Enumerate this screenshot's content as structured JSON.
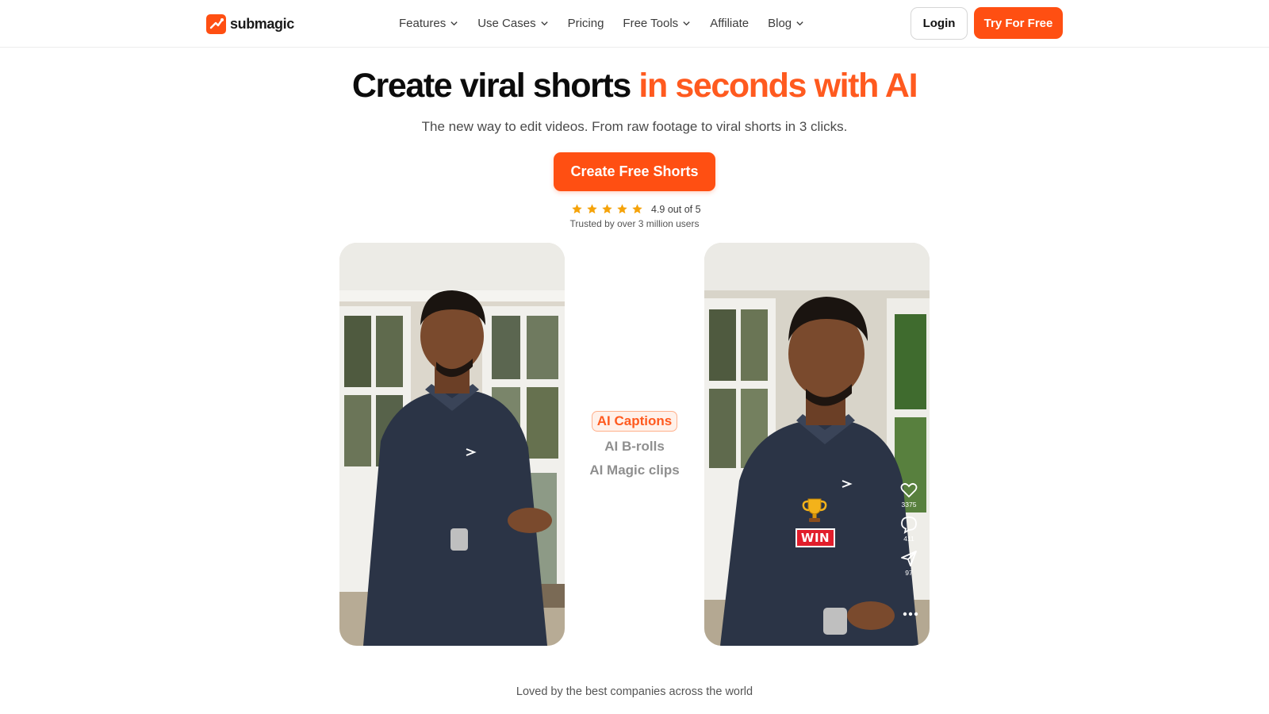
{
  "brand": {
    "name": "submagic",
    "accent": "#ff4f12"
  },
  "nav": {
    "items": [
      {
        "label": "Features",
        "dropdown": true
      },
      {
        "label": "Use Cases",
        "dropdown": true
      },
      {
        "label": "Pricing",
        "dropdown": false
      },
      {
        "label": "Free Tools",
        "dropdown": true
      },
      {
        "label": "Affiliate",
        "dropdown": false
      },
      {
        "label": "Blog",
        "dropdown": true
      }
    ],
    "login_label": "Login",
    "try_label": "Try For Free"
  },
  "hero": {
    "title_main": "Create viral shorts",
    "title_accent": "in seconds with AI",
    "subtitle": "The new way to edit videos. From raw footage to viral shorts in 3 clicks.",
    "cta_label": "Create Free Shorts",
    "rating_stars": 5,
    "rating_text": "4.9 out of 5",
    "trusted_text": "Trusted by over 3 million users"
  },
  "features": {
    "active": "AI Captions",
    "others": [
      "AI B-rolls",
      "AI Magic clips"
    ]
  },
  "video_right": {
    "caption_word": "WIN",
    "caption_emoji": "trophy-icon",
    "likes": "3375",
    "comments": "411",
    "shares": "97"
  },
  "footer": {
    "loved_text": "Loved by the best companies across the world"
  }
}
